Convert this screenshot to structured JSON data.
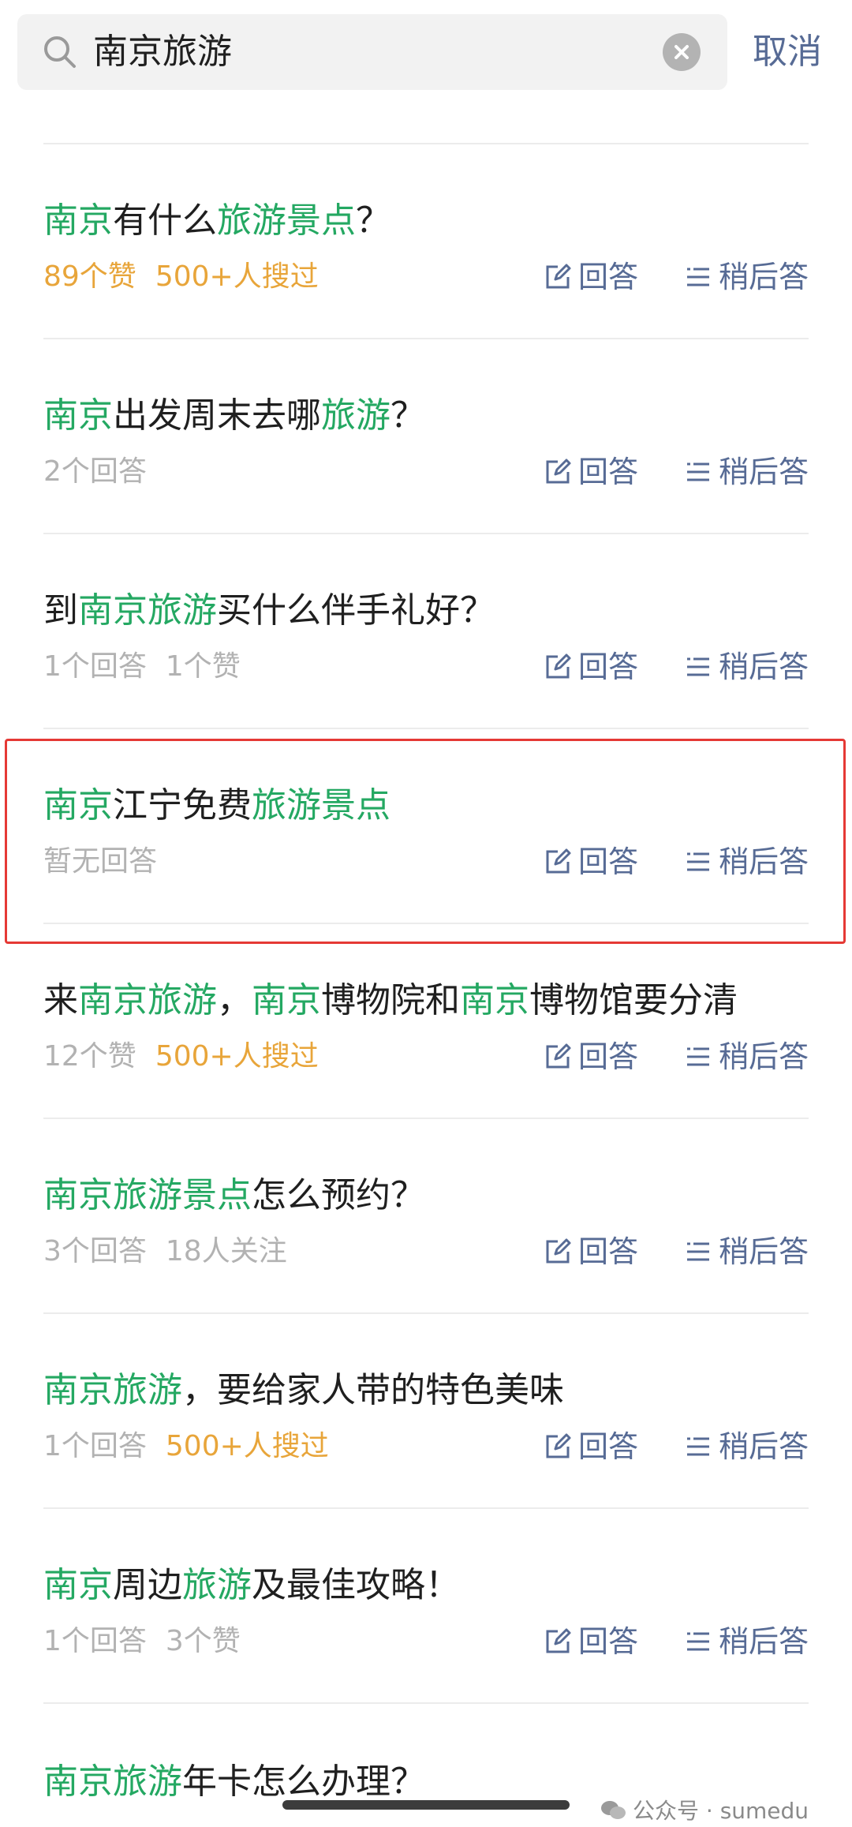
{
  "search": {
    "query": "南京旅游",
    "cancel_label": "取消"
  },
  "actions": {
    "answer_label": "回答",
    "later_label": "稍后答"
  },
  "items": [
    {
      "title": [
        {
          "t": "南京",
          "hl": true
        },
        {
          "t": "有什么",
          "hl": false
        },
        {
          "t": "旅游景点",
          "hl": true
        },
        {
          "t": "？",
          "hl": false
        }
      ],
      "meta": [
        {
          "t": "89个赞",
          "orange": true
        },
        {
          "t": "500+人搜过",
          "orange": true
        }
      ]
    },
    {
      "title": [
        {
          "t": "南京",
          "hl": true
        },
        {
          "t": "出发周末去哪",
          "hl": false
        },
        {
          "t": "旅游",
          "hl": true
        },
        {
          "t": "？",
          "hl": false
        }
      ],
      "meta": [
        {
          "t": "2个回答",
          "orange": false
        }
      ]
    },
    {
      "title": [
        {
          "t": "到",
          "hl": false
        },
        {
          "t": "南京旅游",
          "hl": true
        },
        {
          "t": "买什么伴手礼好？",
          "hl": false
        }
      ],
      "meta": [
        {
          "t": "1个回答",
          "orange": false
        },
        {
          "t": "1个赞",
          "orange": false
        }
      ]
    },
    {
      "title": [
        {
          "t": "南京",
          "hl": true
        },
        {
          "t": "江宁免费",
          "hl": false
        },
        {
          "t": "旅游景点",
          "hl": true
        }
      ],
      "meta": [
        {
          "t": "暂无回答",
          "orange": false
        }
      ]
    },
    {
      "title": [
        {
          "t": "来",
          "hl": false
        },
        {
          "t": "南京旅游",
          "hl": true
        },
        {
          "t": "，",
          "hl": false
        },
        {
          "t": "南京",
          "hl": true
        },
        {
          "t": "博物院和",
          "hl": false
        },
        {
          "t": "南京",
          "hl": true
        },
        {
          "t": "博物馆要分清",
          "hl": false
        }
      ],
      "meta": [
        {
          "t": "12个赞",
          "orange": false
        },
        {
          "t": "500+人搜过",
          "orange": true
        }
      ]
    },
    {
      "title": [
        {
          "t": "南京旅游景点",
          "hl": true
        },
        {
          "t": "怎么预约？",
          "hl": false
        }
      ],
      "meta": [
        {
          "t": "3个回答",
          "orange": false
        },
        {
          "t": "18人关注",
          "orange": false
        }
      ]
    },
    {
      "title": [
        {
          "t": "南京旅游",
          "hl": true
        },
        {
          "t": "，要给家人带的特色美味",
          "hl": false
        }
      ],
      "meta": [
        {
          "t": "1个回答",
          "orange": false
        },
        {
          "t": "500+人搜过",
          "orange": true
        }
      ]
    },
    {
      "title": [
        {
          "t": "南京",
          "hl": true
        },
        {
          "t": "周边",
          "hl": false
        },
        {
          "t": "旅游",
          "hl": true
        },
        {
          "t": "及最佳攻略！",
          "hl": false
        }
      ],
      "meta": [
        {
          "t": "1个回答",
          "orange": false
        },
        {
          "t": "3个赞",
          "orange": false
        }
      ]
    }
  ],
  "partial_item": {
    "title": [
      {
        "t": "南京旅游",
        "hl": true
      },
      {
        "t": "年卡怎么办理？",
        "hl": false
      }
    ]
  },
  "watermark": {
    "text": "公众号 · sumedu"
  },
  "colors": {
    "highlight": "#24a862",
    "link": "#576b95",
    "orange": "#e8a53a",
    "muted": "#b2b2b2",
    "annotation_box": "#e53935"
  }
}
